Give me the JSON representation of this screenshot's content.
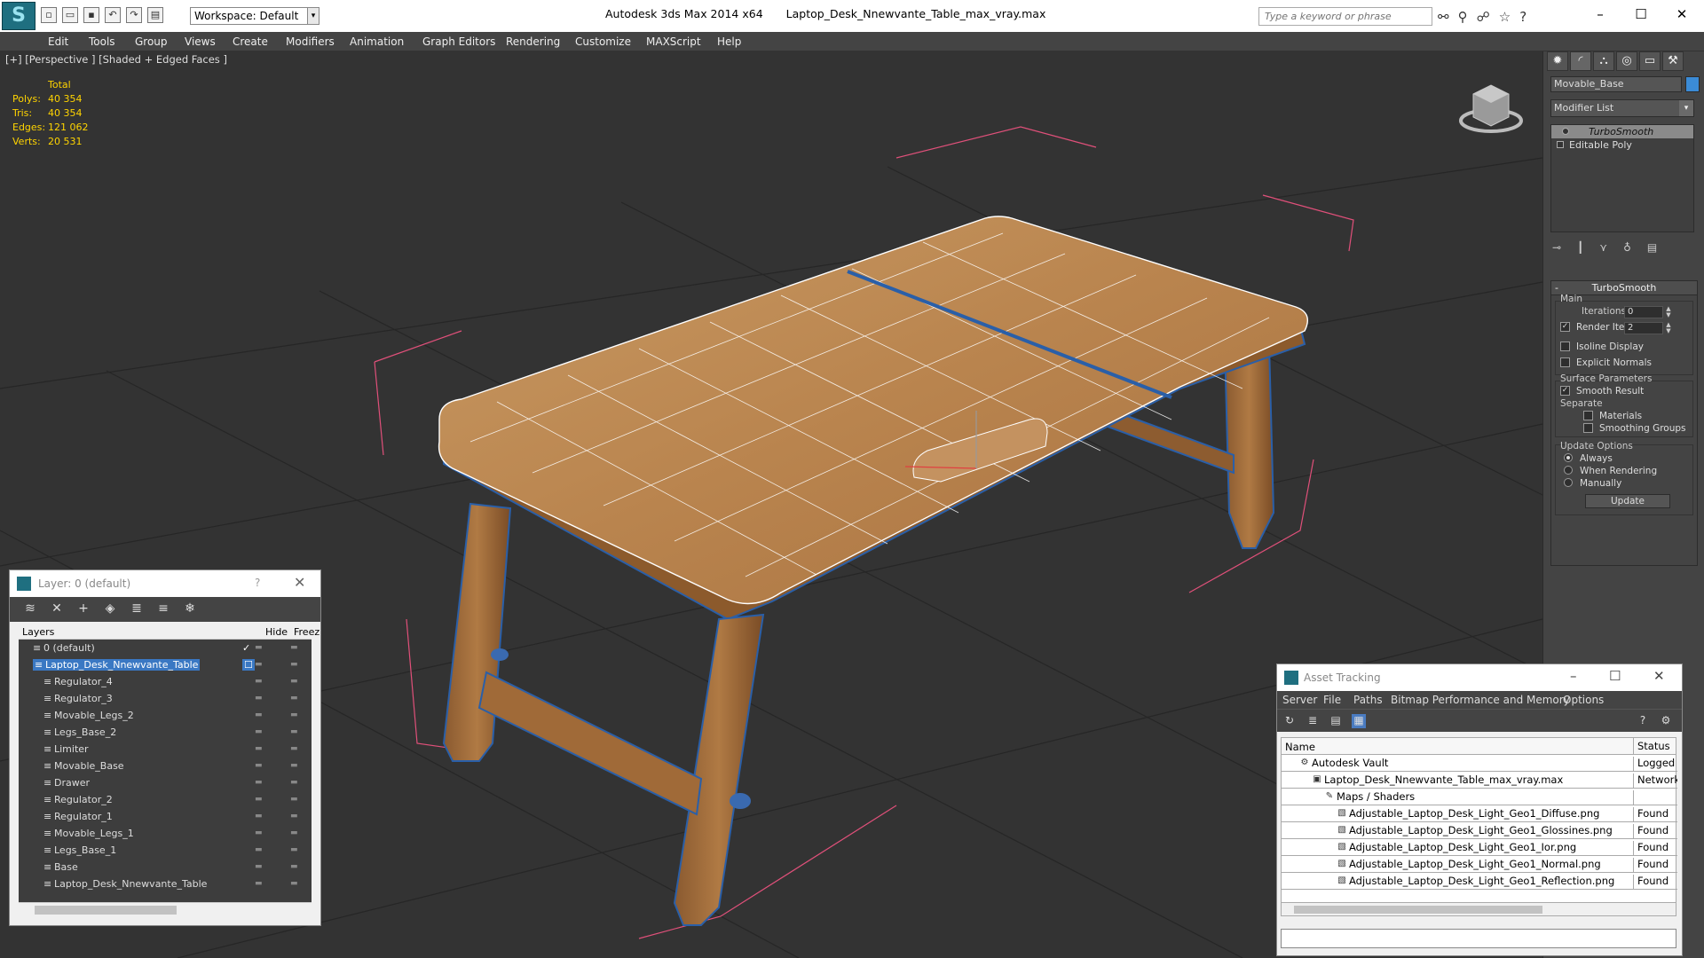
{
  "app": {
    "title": "Autodesk 3ds Max  2014 x64",
    "file": "Laptop_Desk_Nnewvante_Table_max_vray.max",
    "workspace": "Workspace: Default",
    "search_placeholder": "Type a keyword or phrase"
  },
  "menu": [
    "Edit",
    "Tools",
    "Group",
    "Views",
    "Create",
    "Modifiers",
    "Animation",
    "Graph Editors",
    "Rendering",
    "Customize",
    "MAXScript",
    "Help"
  ],
  "viewport": {
    "label": "[+] [Perspective ] [Shaded + Edged Faces ]",
    "stats": {
      "header": "Total",
      "rows": [
        {
          "k": "Polys:",
          "v": "40 354"
        },
        {
          "k": "Tris:",
          "v": "40 354"
        },
        {
          "k": "Edges:",
          "v": "121 062"
        },
        {
          "k": "Verts:",
          "v": "20 531"
        }
      ]
    }
  },
  "command_panel": {
    "object_name": "Movable_Base",
    "object_color": "#3b8bd6",
    "modifier_list": "Modifier List",
    "stack": [
      "TurboSmooth",
      "Editable Poly"
    ],
    "rollout": {
      "title": "TurboSmooth",
      "main": "Main",
      "iterations_label": "Iterations:",
      "iterations": "0",
      "render_iters_label": "Render Iters:",
      "render_iters": "2",
      "isoline": "Isoline Display",
      "explicit_normals": "Explicit Normals",
      "surface": "Surface Parameters",
      "smooth_result": "Smooth Result",
      "separate": "Separate",
      "materials": "Materials",
      "smoothing_groups": "Smoothing Groups",
      "update_options": "Update Options",
      "always": "Always",
      "when_rendering": "When Rendering",
      "manually": "Manually",
      "update": "Update"
    }
  },
  "layer_window": {
    "title": "Layer: 0 (default)",
    "help": "?",
    "col_layers": "Layers",
    "col_hide": "Hide",
    "col_freeze": "Freez",
    "rows": [
      {
        "name": "0 (default)",
        "indent": 0
      },
      {
        "name": "Laptop_Desk_Nnewvante_Table",
        "indent": 0,
        "selected": true
      },
      {
        "name": "Regulator_4",
        "indent": 1
      },
      {
        "name": "Regulator_3",
        "indent": 1
      },
      {
        "name": "Movable_Legs_2",
        "indent": 1
      },
      {
        "name": "Legs_Base_2",
        "indent": 1
      },
      {
        "name": "Limiter",
        "indent": 1
      },
      {
        "name": "Movable_Base",
        "indent": 1
      },
      {
        "name": "Drawer",
        "indent": 1
      },
      {
        "name": "Regulator_2",
        "indent": 1
      },
      {
        "name": "Regulator_1",
        "indent": 1
      },
      {
        "name": "Movable_Legs_1",
        "indent": 1
      },
      {
        "name": "Legs_Base_1",
        "indent": 1
      },
      {
        "name": "Base",
        "indent": 1
      },
      {
        "name": "Laptop_Desk_Nnewvante_Table",
        "indent": 1
      }
    ]
  },
  "asset_window": {
    "title": "Asset Tracking",
    "menu": [
      "Server",
      "File",
      "Paths",
      "Bitmap Performance and Memory",
      "Options"
    ],
    "col_name": "Name",
    "col_status": "Status",
    "rows": [
      {
        "name": "Autodesk Vault",
        "status": "Logged O",
        "indent": 0
      },
      {
        "name": "Laptop_Desk_Nnewvante_Table_max_vray.max",
        "status": "Network I",
        "indent": 1
      },
      {
        "name": "Maps / Shaders",
        "status": "",
        "indent": 2
      },
      {
        "name": "Adjustable_Laptop_Desk_Light_Geo1_Diffuse.png",
        "status": "Found",
        "indent": 3
      },
      {
        "name": "Adjustable_Laptop_Desk_Light_Geo1_Glossines.png",
        "status": "Found",
        "indent": 3
      },
      {
        "name": "Adjustable_Laptop_Desk_Light_Geo1_Ior.png",
        "status": "Found",
        "indent": 3
      },
      {
        "name": "Adjustable_Laptop_Desk_Light_Geo1_Normal.png",
        "status": "Found",
        "indent": 3
      },
      {
        "name": "Adjustable_Laptop_Desk_Light_Geo1_Reflection.png",
        "status": "Found",
        "indent": 3
      }
    ]
  }
}
